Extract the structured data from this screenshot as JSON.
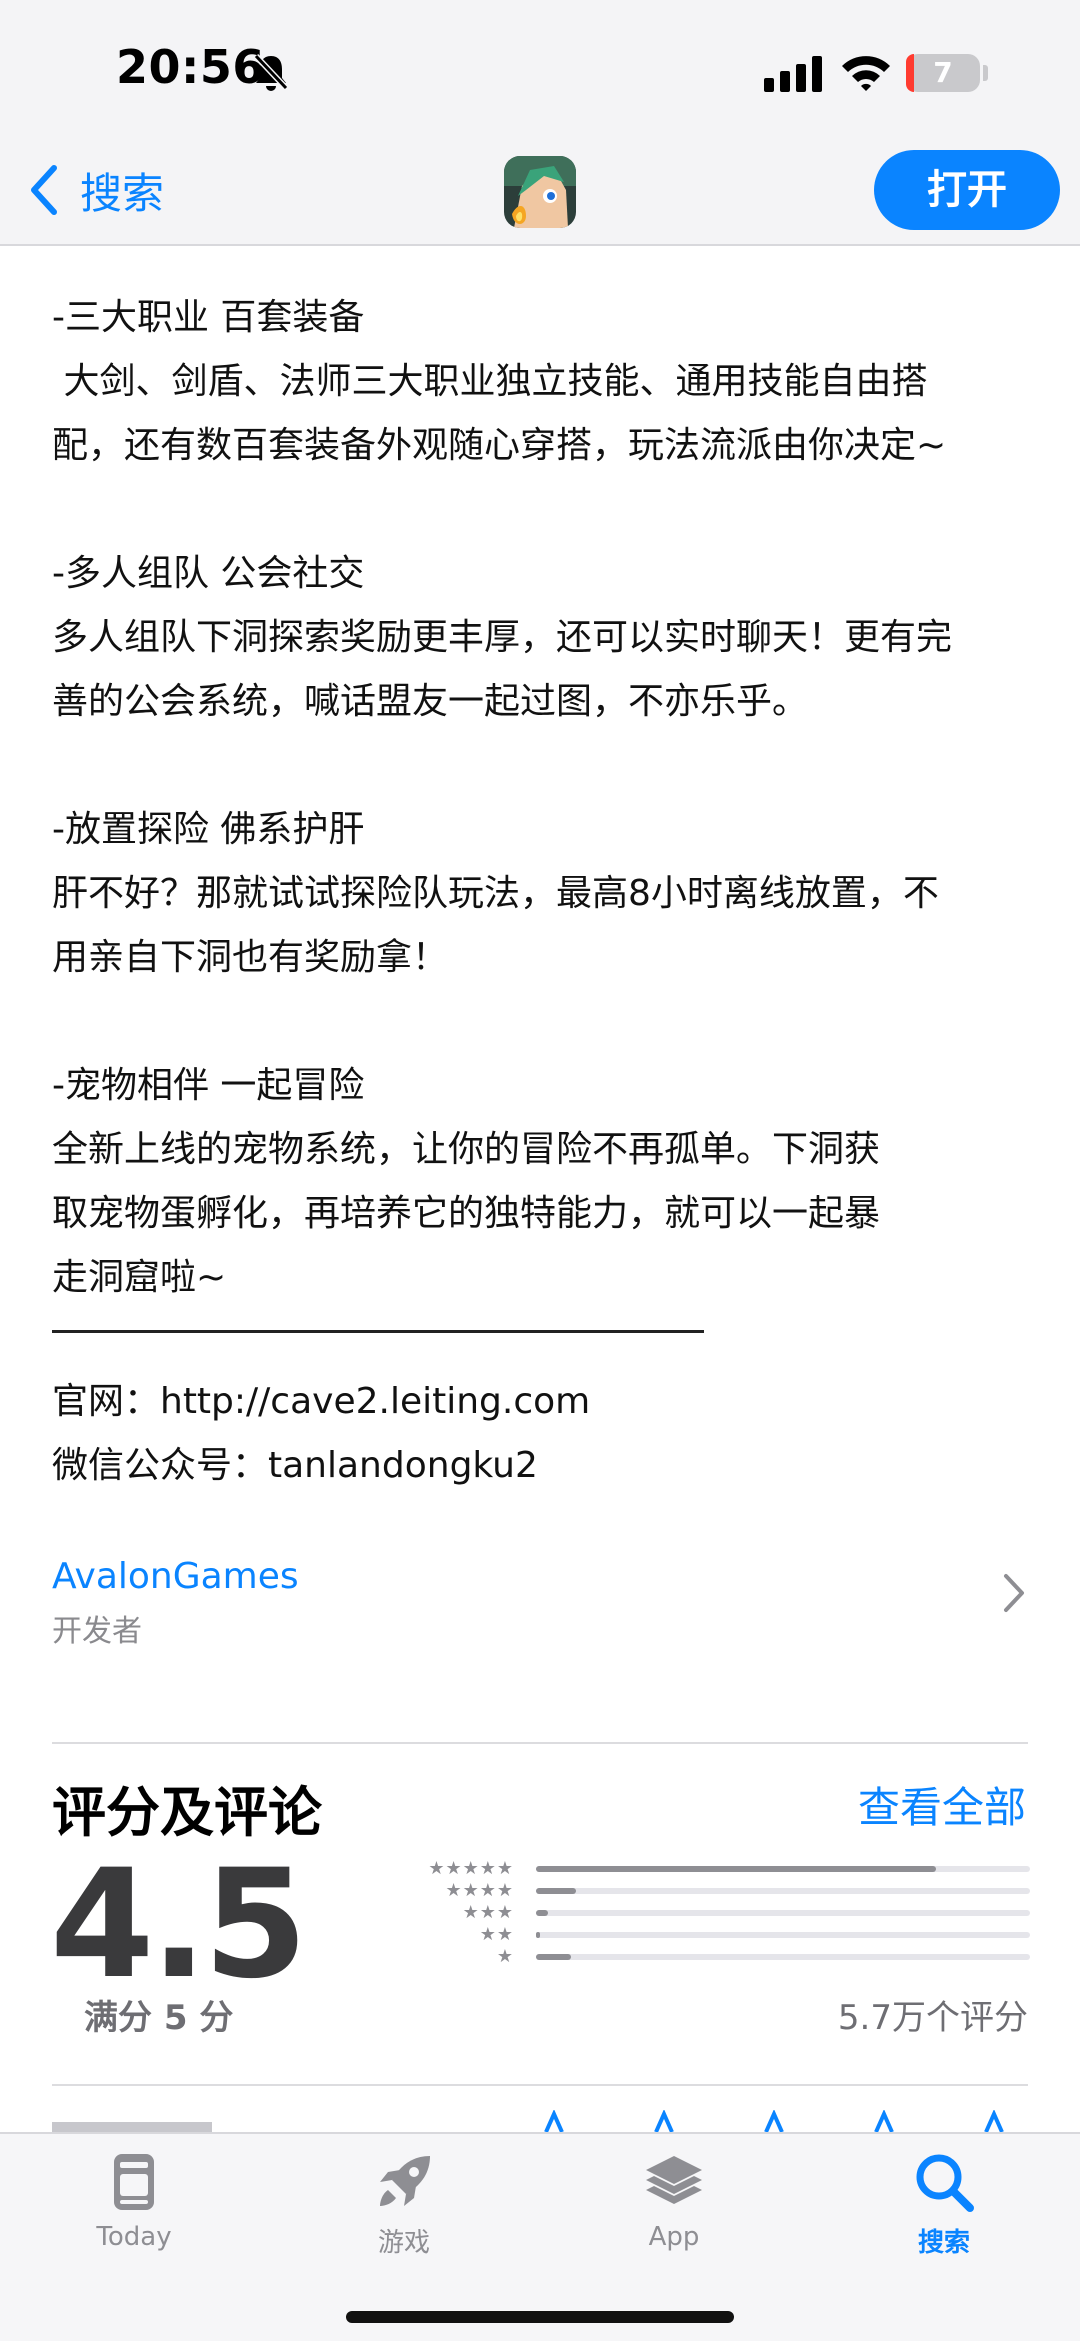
{
  "status_bar": {
    "time": "20:56",
    "battery_level": "7",
    "icons": [
      "bell-slash-icon",
      "cellular-signal-icon",
      "wifi-icon",
      "battery-icon"
    ]
  },
  "nav": {
    "back_label": "搜索",
    "open_label": "打开",
    "app_icon": "game-app-icon",
    "accent": "#0a84ff"
  },
  "description": {
    "sections": [
      {
        "heading": "-三大职业 百套装备",
        "lines": [
          " 大剑、剑盾、法师三大职业独立技能、通用技能自由搭",
          "配，还有数百套装备外观随心穿搭，玩法流派由你决定~"
        ]
      },
      {
        "heading": "-多人组队 公会社交",
        "lines": [
          "多人组队下洞探索奖励更丰厚，还可以实时聊天！更有完",
          "善的公会系统，喊话盟友一起过图，不亦乐乎。"
        ]
      },
      {
        "heading": "-放置探险 佛系护肝",
        "lines": [
          "肝不好？那就试试探险队玩法，最高8小时离线放置，不",
          "用亲自下洞也有奖励拿！"
        ]
      },
      {
        "heading": "-宠物相伴 一起冒险",
        "lines": [
          "全新上线的宠物系统，让你的冒险不再孤单。下洞获",
          "取宠物蛋孵化，再培养它的独特能力，就可以一起暴",
          "走洞窟啦~"
        ]
      }
    ],
    "website": "官网：http://cave2.leiting.com",
    "wechat": "微信公众号：tanlandongku2"
  },
  "developer": {
    "name": "AvalonGames",
    "role": "开发者"
  },
  "ratings": {
    "title": "评分及评论",
    "see_all": "查看全部",
    "score": "4.5",
    "out_of": "满分 5 分",
    "count": "5.7万个评分",
    "star_labels": [
      "★★★★★",
      "★★★★",
      "★★★",
      "★★",
      "★"
    ],
    "distribution": [
      0.81,
      0.08,
      0.025,
      0.008,
      0.07
    ]
  },
  "tab_bar": {
    "tabs": [
      {
        "label": "Today",
        "icon": "today-icon",
        "active": false
      },
      {
        "label": "游戏",
        "icon": "rocket-icon",
        "active": false
      },
      {
        "label": "App",
        "icon": "app-stack-icon",
        "active": false
      },
      {
        "label": "搜索",
        "icon": "search-icon",
        "active": true
      }
    ]
  }
}
